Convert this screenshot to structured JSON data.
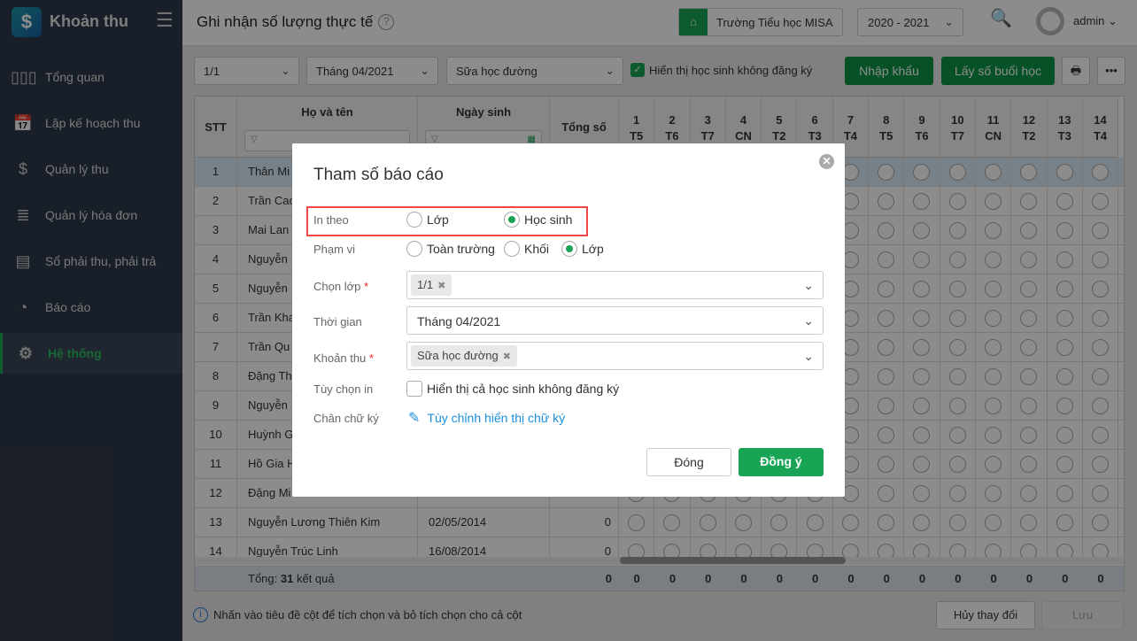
{
  "sidebar": {
    "app_name": "Khoản thu",
    "logo_symbol": "$",
    "items": [
      {
        "label": "Tổng quan",
        "icon": "bar-chart-icon"
      },
      {
        "label": "Lập kế hoạch thu",
        "icon": "calendar-dollar-icon"
      },
      {
        "label": "Quản lý thu",
        "icon": "hand-coin-icon"
      },
      {
        "label": "Quản lý hóa đơn",
        "icon": "document-icon"
      },
      {
        "label": "Sổ phải thu, phải trả",
        "icon": "ledger-icon"
      },
      {
        "label": "Báo cáo",
        "icon": "pie-chart-icon"
      },
      {
        "label": "Hệ thống",
        "icon": "gear-icon",
        "active": true
      }
    ]
  },
  "header": {
    "title": "Ghi nhận số lượng thực tế",
    "school": "Trường Tiểu học MISA",
    "year": "2020 - 2021",
    "user": "admin"
  },
  "toolbar": {
    "class": "1/1",
    "month": "Tháng 04/2021",
    "fee": "Sữa học đường",
    "show_unregistered": "Hiển thị học sinh không đăng ký",
    "import": "Nhập khẩu",
    "get_sessions": "Lấy số buổi học"
  },
  "table": {
    "headers": {
      "stt": "STT",
      "name": "Họ và tên",
      "dob": "Ngày sinh",
      "total": "Tổng số"
    },
    "days": [
      {
        "d": "1",
        "w": "T5"
      },
      {
        "d": "2",
        "w": "T6"
      },
      {
        "d": "3",
        "w": "T7"
      },
      {
        "d": "4",
        "w": "CN"
      },
      {
        "d": "5",
        "w": "T2"
      },
      {
        "d": "6",
        "w": "T3"
      },
      {
        "d": "7",
        "w": "T4"
      },
      {
        "d": "8",
        "w": "T5"
      },
      {
        "d": "9",
        "w": "T6"
      },
      {
        "d": "10",
        "w": "T7"
      },
      {
        "d": "11",
        "w": "CN"
      },
      {
        "d": "12",
        "w": "T2"
      },
      {
        "d": "13",
        "w": "T3"
      },
      {
        "d": "14",
        "w": "T4"
      }
    ],
    "rows": [
      {
        "stt": "1",
        "name": "Thân Mi",
        "dob": "",
        "total": ""
      },
      {
        "stt": "2",
        "name": "Trần Cao",
        "dob": "",
        "total": ""
      },
      {
        "stt": "3",
        "name": "Mai Lan",
        "dob": "",
        "total": ""
      },
      {
        "stt": "4",
        "name": "Nguyễn",
        "dob": "",
        "total": ""
      },
      {
        "stt": "5",
        "name": "Nguyễn",
        "dob": "",
        "total": ""
      },
      {
        "stt": "6",
        "name": "Trần Kha",
        "dob": "",
        "total": ""
      },
      {
        "stt": "7",
        "name": "Trần Qu",
        "dob": "",
        "total": ""
      },
      {
        "stt": "8",
        "name": "Đặng Th",
        "dob": "",
        "total": ""
      },
      {
        "stt": "9",
        "name": "Nguyễn",
        "dob": "",
        "total": ""
      },
      {
        "stt": "10",
        "name": "Huỳnh G",
        "dob": "",
        "total": ""
      },
      {
        "stt": "11",
        "name": "Hồ Gia H",
        "dob": "",
        "total": ""
      },
      {
        "stt": "12",
        "name": "Đặng Mi",
        "dob": "",
        "total": ""
      },
      {
        "stt": "13",
        "name": "Nguyễn Lương Thiên Kim",
        "dob": "02/05/2014",
        "total": "0"
      },
      {
        "stt": "14",
        "name": "Nguyễn Trúc Linh",
        "dob": "16/08/2014",
        "total": "0"
      }
    ],
    "footer": {
      "label": "Tổng:",
      "count": "31",
      "suffix": "kết quả",
      "total": "0",
      "day_totals": [
        "0",
        "0",
        "0",
        "0",
        "0",
        "0",
        "0",
        "0",
        "0",
        "0",
        "0",
        "0",
        "0",
        "0"
      ]
    }
  },
  "bottom": {
    "hint": "Nhấn vào tiêu đề cột để tích chọn và bỏ tích chọn cho cả cột",
    "cancel": "Hủy thay đổi",
    "save": "Lưu"
  },
  "modal": {
    "title": "Tham số báo cáo",
    "print_by": {
      "label": "In theo",
      "options": [
        "Lớp",
        "Học sinh"
      ],
      "selected": "Học sinh"
    },
    "scope": {
      "label": "Phạm vi",
      "options": [
        "Toàn trường",
        "Khối",
        "Lớp"
      ],
      "selected": "Lớp"
    },
    "class": {
      "label": "Chọn lớp",
      "tag": "1/1"
    },
    "time": {
      "label": "Thời gian",
      "value": "Tháng 04/2021"
    },
    "fee": {
      "label": "Khoản thu",
      "tag": "Sữa học đường"
    },
    "print_option": {
      "label": "Tùy chọn in",
      "checkbox": "Hiển thị cả học sinh không đăng ký",
      "checked": false
    },
    "signature": {
      "label": "Chân chữ ký",
      "link": "Tùy chỉnh hiển thị chữ ký"
    },
    "close": "Đóng",
    "ok": "Đồng ý",
    "required_mark": "*"
  },
  "colors": {
    "accent": "#18a454",
    "sidebar": "#2f3949",
    "highlight": "#f04848",
    "link": "#1a8fdd"
  }
}
